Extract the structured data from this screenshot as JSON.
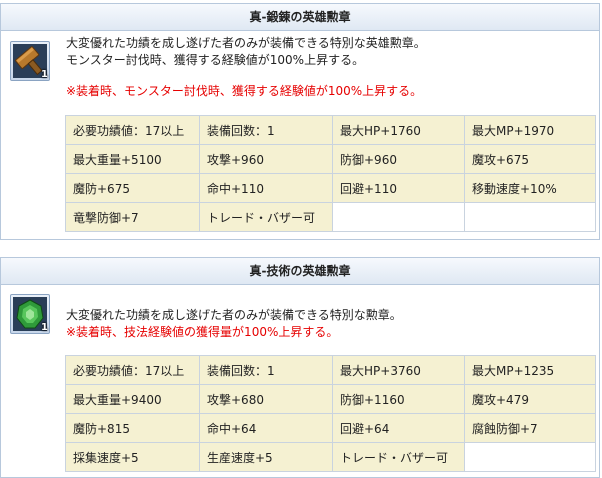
{
  "items": [
    {
      "title": "真-鍛錬の英雄勲章",
      "badge": "1",
      "icon": "hammer-medal-icon",
      "desc_line1": "大変優れた功績を成し遂げた者のみが装備できる特別な英雄勲章。",
      "desc_line2": "モンスター討伐時、獲得する経験値が100%上昇する。",
      "note": "※装着時、モンスター討伐時、獲得する経験値が100%上昇する。",
      "stats": [
        [
          "必要功績値：17以上",
          "装備回数：1",
          "最大HP+1760",
          "最大MP+1970"
        ],
        [
          "最大重量+5100",
          "攻撃+960",
          "防御+960",
          "魔攻+675"
        ],
        [
          "魔防+675",
          "命中+110",
          "回避+110",
          "移動速度+10%"
        ],
        [
          "竜撃防御+7",
          "トレード・バザー可",
          "",
          ""
        ]
      ]
    },
    {
      "title": "真-技術の英雄勲章",
      "badge": "1",
      "icon": "green-gem-medal-icon",
      "desc_line1": "大変優れた功績を成し遂げた者のみが装備できる特別な勲章。",
      "note": "※装着時、技法経験値の獲得量が100%上昇する。",
      "stats": [
        [
          "必要功績値：17以上",
          "装備回数：1",
          "最大HP+3760",
          "最大MP+1235"
        ],
        [
          "最大重量+9400",
          "攻撃+680",
          "防御+1160",
          "魔攻+479"
        ],
        [
          "魔防+815",
          "命中+64",
          "回避+64",
          "腐蝕防御+7"
        ],
        [
          "採集速度+5",
          "生産速度+5",
          "トレード・バザー可",
          ""
        ]
      ]
    }
  ],
  "colors": {
    "header_bg": "#dfe8f3",
    "border": "#b7c8dc",
    "cell_bg": "#f5f1d2",
    "note_red": "#e60000"
  }
}
